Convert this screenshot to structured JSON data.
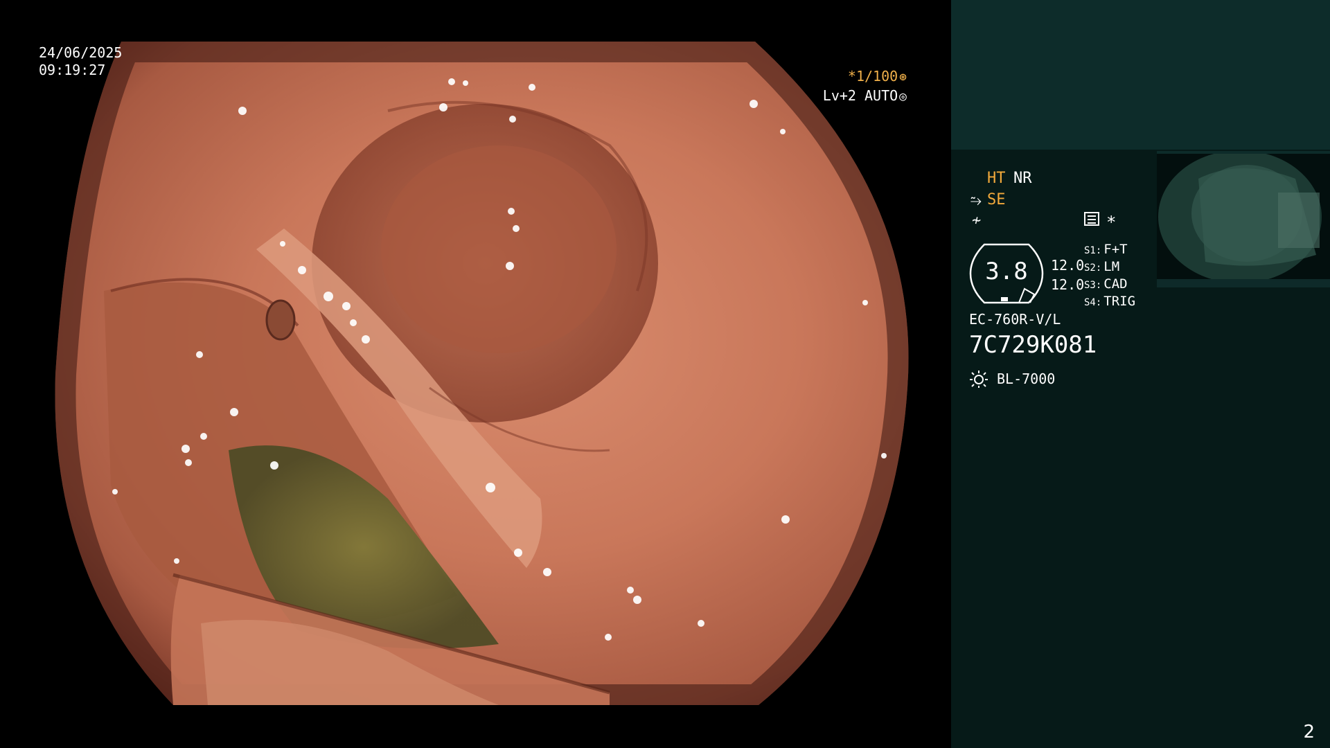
{
  "overlay": {
    "date": "24/06/2025",
    "time": "09:19:27",
    "shutter": "*1/100",
    "level": "Lv+2 AUTO"
  },
  "panel": {
    "ht": "HT",
    "nr": "NR",
    "se": "SE",
    "zoom": "3.8",
    "value_a": "12.0",
    "value_b": "12.0",
    "switches": [
      {
        "key": "S1:",
        "value": "F+T"
      },
      {
        "key": "S2:",
        "value": "LM"
      },
      {
        "key": "S3:",
        "value": "CAD"
      },
      {
        "key": "S4:",
        "value": "TRIG"
      }
    ],
    "scope_model": "EC-760R-V/L",
    "scope_serial": "7C729K081",
    "light_source": "BL-7000"
  },
  "page_number": "2",
  "colors": {
    "accent": "#f2a93b",
    "panel_bg": "#061a18",
    "panel_top": "#0d2c2a"
  },
  "icons": [
    "freeze-icon",
    "structure-enhance-icon",
    "menu-icon",
    "asterisk-icon",
    "light-source-icon",
    "shutter-icon",
    "auto-iris-icon"
  ]
}
